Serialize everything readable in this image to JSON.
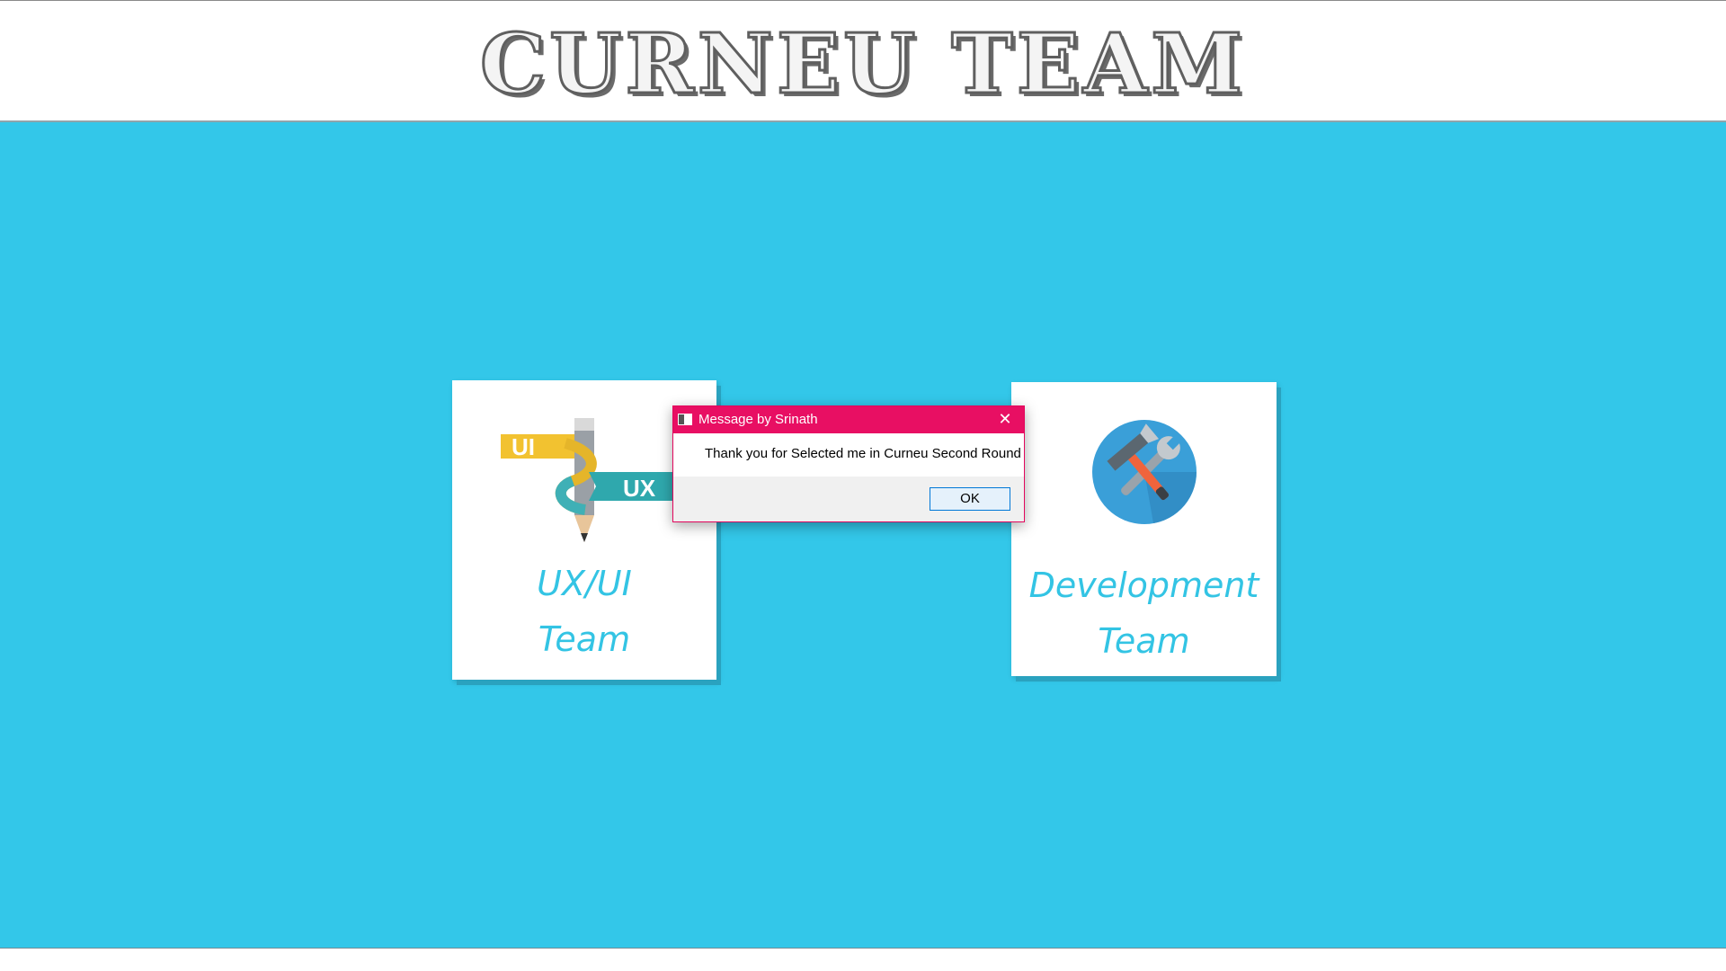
{
  "header": {
    "title": "CURNEU TEAM"
  },
  "cards": [
    {
      "id": "ux",
      "label_line1": "UX/UI",
      "label_line2": "Team",
      "icon": "ui-ux-pencil-icon",
      "icon_text_ui": "UI",
      "icon_text_ux": "UX"
    },
    {
      "id": "dev",
      "label_line1": "Development",
      "label_line2": "Team",
      "icon": "wrench-hammer-icon"
    }
  ],
  "dialog": {
    "title": "Message by Srinath",
    "message": "Thank you for Selected me in Curneu Second Round",
    "ok_label": "OK",
    "close_glyph": "✕"
  },
  "colors": {
    "background": "#33c7e9",
    "label": "#33c4e4",
    "dialog_accent": "#e80f63"
  }
}
